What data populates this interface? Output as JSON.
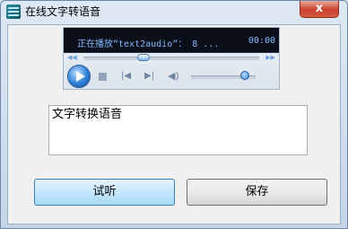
{
  "window": {
    "title": "在线文字转语音",
    "close_icon": "close-icon",
    "close_glyph": "x"
  },
  "player": {
    "now_playing": "正在播放“text2audio”： 8 ...",
    "time": "00:00",
    "seek_left_icon": "seek-back-icon",
    "seek_right_icon": "seek-forward-icon",
    "icons": [
      "play-icon",
      "stop-icon",
      "previous-icon",
      "next-icon",
      "volume-icon"
    ]
  },
  "text_input": {
    "value": "文字转换语音"
  },
  "buttons": {
    "listen_label": "试听",
    "save_label": "保存"
  },
  "colors": {
    "close_button": "#c8412b",
    "primary_button": "#c5e6fb",
    "player_display": "#0a0f1a"
  }
}
